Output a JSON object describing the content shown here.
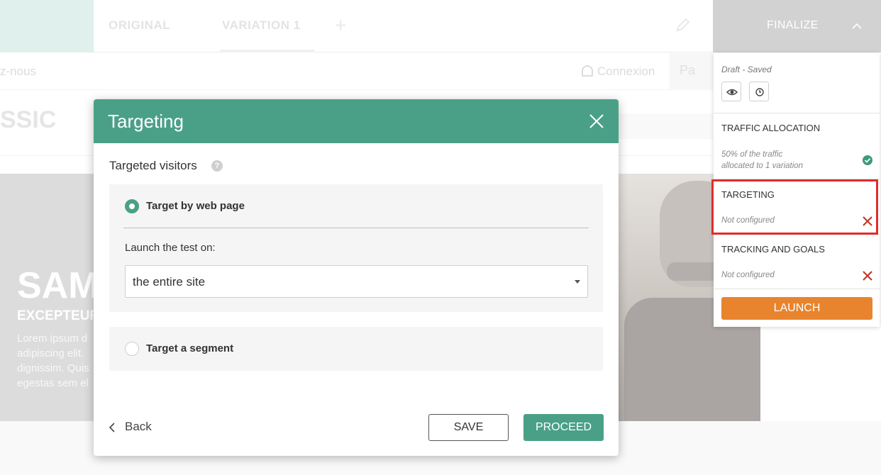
{
  "editor": {
    "tabs": [
      {
        "label": "ORIGINAL"
      },
      {
        "label": "VARIATION 1"
      }
    ],
    "finalize_label": "FINALIZE"
  },
  "site": {
    "nav_contact": "z-nous",
    "nav_login": "Connexion",
    "nav_cart": "Pa",
    "brand": "SSIC",
    "hero_title": "SAM",
    "hero_subtitle": "EXCEPTEUR",
    "hero_lines": [
      "Lorem ipsum d",
      "adipiscing elit.",
      "dignissim. Quis",
      "egestas sem el"
    ]
  },
  "panel": {
    "status": "Draft - Saved",
    "sections": [
      {
        "title": "TRAFFIC ALLOCATION",
        "note_line1": "50% of the traffic",
        "note_line2": "allocated to 1 variation",
        "state": "configured"
      },
      {
        "title": "TARGETING",
        "note_line1": "Not configured",
        "state": "not-configured",
        "highlighted": true
      },
      {
        "title": "TRACKING AND GOALS",
        "note_line1": "Not configured",
        "state": "not-configured"
      }
    ],
    "launch_label": "LAUNCH",
    "colors": {
      "check": "#3b9b7b",
      "error": "#c0392b",
      "launch": "#e8842d",
      "highlight": "#e02d2a"
    }
  },
  "modal": {
    "title": "Targeting",
    "subtitle": "Targeted visitors",
    "help_icon": "?",
    "options": [
      {
        "label": "Target by web page",
        "selected": true
      },
      {
        "label": "Target a segment",
        "selected": false
      }
    ],
    "launch_label": "Launch the test on:",
    "select_value": "the entire site",
    "back_label": "Back",
    "save_label": "SAVE",
    "proceed_label": "PROCEED",
    "colors": {
      "header": "#4aa087"
    }
  }
}
